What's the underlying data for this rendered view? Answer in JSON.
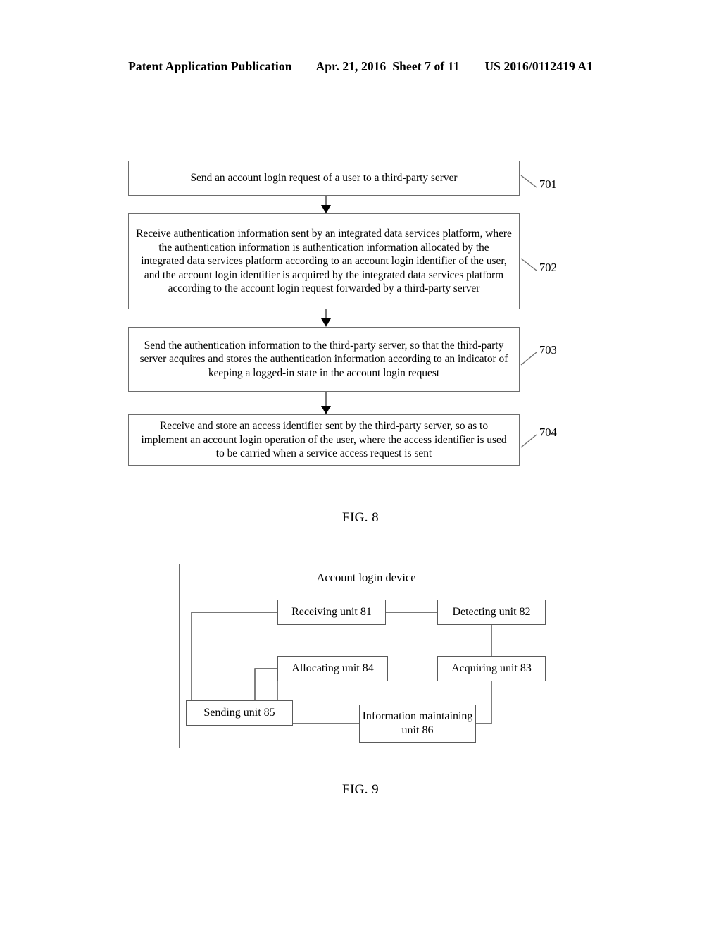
{
  "header": {
    "publication": "Patent Application Publication",
    "date_sheet": "Apr. 21, 2016  Sheet 7 of 11",
    "patent_number": "US 2016/0112419 A1"
  },
  "fig8": {
    "caption": "FIG. 8",
    "steps": [
      {
        "ref": "701",
        "text": "Send an account login request of a user to a third-party server"
      },
      {
        "ref": "702",
        "text": "Receive authentication information sent by an integrated data services platform, where the authentication information is authentication information allocated by the integrated data services platform according to an account login identifier of the user, and the account login identifier is acquired by the integrated data services platform according to the account login request forwarded by a third-party server"
      },
      {
        "ref": "703",
        "text": "Send the authentication information to the third-party server, so that the third-party server acquires and stores the authentication information according to an indicator of keeping a logged-in state in the account login request"
      },
      {
        "ref": "704",
        "text": "Receive and store an access identifier sent by the third-party server, so as to implement an account login operation of the user, where the access identifier is used to be carried when a service access request is sent"
      }
    ]
  },
  "fig9": {
    "caption": "FIG. 9",
    "title": "Account login device",
    "units": [
      {
        "id": "81",
        "label": "Receiving unit 81"
      },
      {
        "id": "82",
        "label": "Detecting unit 82"
      },
      {
        "id": "83",
        "label": "Acquiring unit 83"
      },
      {
        "id": "84",
        "label": "Allocating unit 84"
      },
      {
        "id": "85",
        "label": "Sending unit 85"
      },
      {
        "id": "86",
        "label": "Information maintaining unit 86"
      }
    ]
  },
  "colors": {
    "ink": "#000000",
    "box_border": "#6d6d6d",
    "page_background": "#ffffff"
  }
}
